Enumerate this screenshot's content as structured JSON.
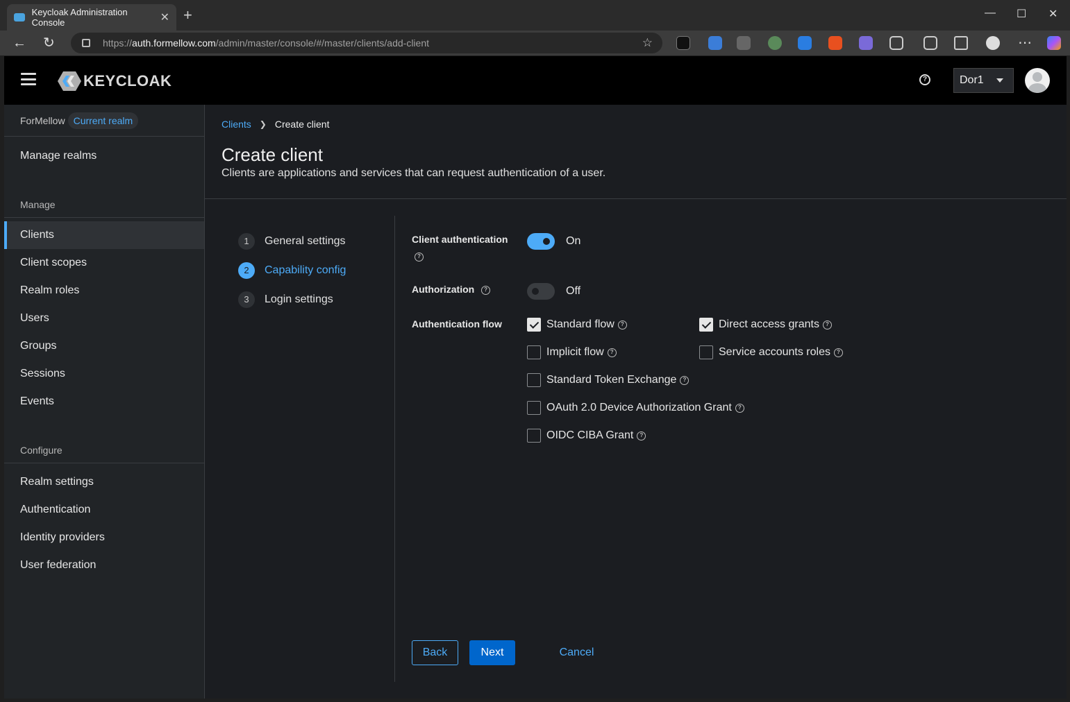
{
  "browser": {
    "tab_title": "Keycloak Administration Console",
    "url_scheme": "https://",
    "url_host": "auth.formellow.com",
    "url_path": "/admin/master/console/#/master/clients/add-client"
  },
  "masthead": {
    "logo_text": "KEYCLOAK",
    "user_name": "Dor1"
  },
  "sidebar": {
    "realm_name": "ForMellow",
    "realm_badge": "Current realm",
    "manage_realms": "Manage realms",
    "manage_title": "Manage",
    "manage_items": [
      "Clients",
      "Client scopes",
      "Realm roles",
      "Users",
      "Groups",
      "Sessions",
      "Events"
    ],
    "configure_title": "Configure",
    "configure_items": [
      "Realm settings",
      "Authentication",
      "Identity providers",
      "User federation"
    ]
  },
  "main": {
    "breadcrumb_link": "Clients",
    "breadcrumb_current": "Create client",
    "title": "Create client",
    "description": "Clients are applications and services that can request authentication of a user.",
    "steps": [
      {
        "num": "1",
        "label": "General settings"
      },
      {
        "num": "2",
        "label": "Capability config"
      },
      {
        "num": "3",
        "label": "Login settings"
      }
    ],
    "form": {
      "client_auth_label": "Client authentication",
      "client_auth_state": "On",
      "authorization_label": "Authorization",
      "authorization_state": "Off",
      "auth_flow_label": "Authentication flow",
      "flows": {
        "standard_flow": "Standard flow",
        "direct_access": "Direct access grants",
        "implicit_flow": "Implicit flow",
        "service_accounts": "Service accounts roles",
        "token_exchange": "Standard Token Exchange",
        "device_grant": "OAuth 2.0 Device Authorization Grant",
        "ciba_grant": "OIDC CIBA Grant"
      }
    },
    "buttons": {
      "back": "Back",
      "next": "Next",
      "cancel": "Cancel"
    }
  },
  "colors": {
    "accent": "#4dabf7",
    "primary_button": "#0066cc",
    "background": "#1b1d21"
  }
}
